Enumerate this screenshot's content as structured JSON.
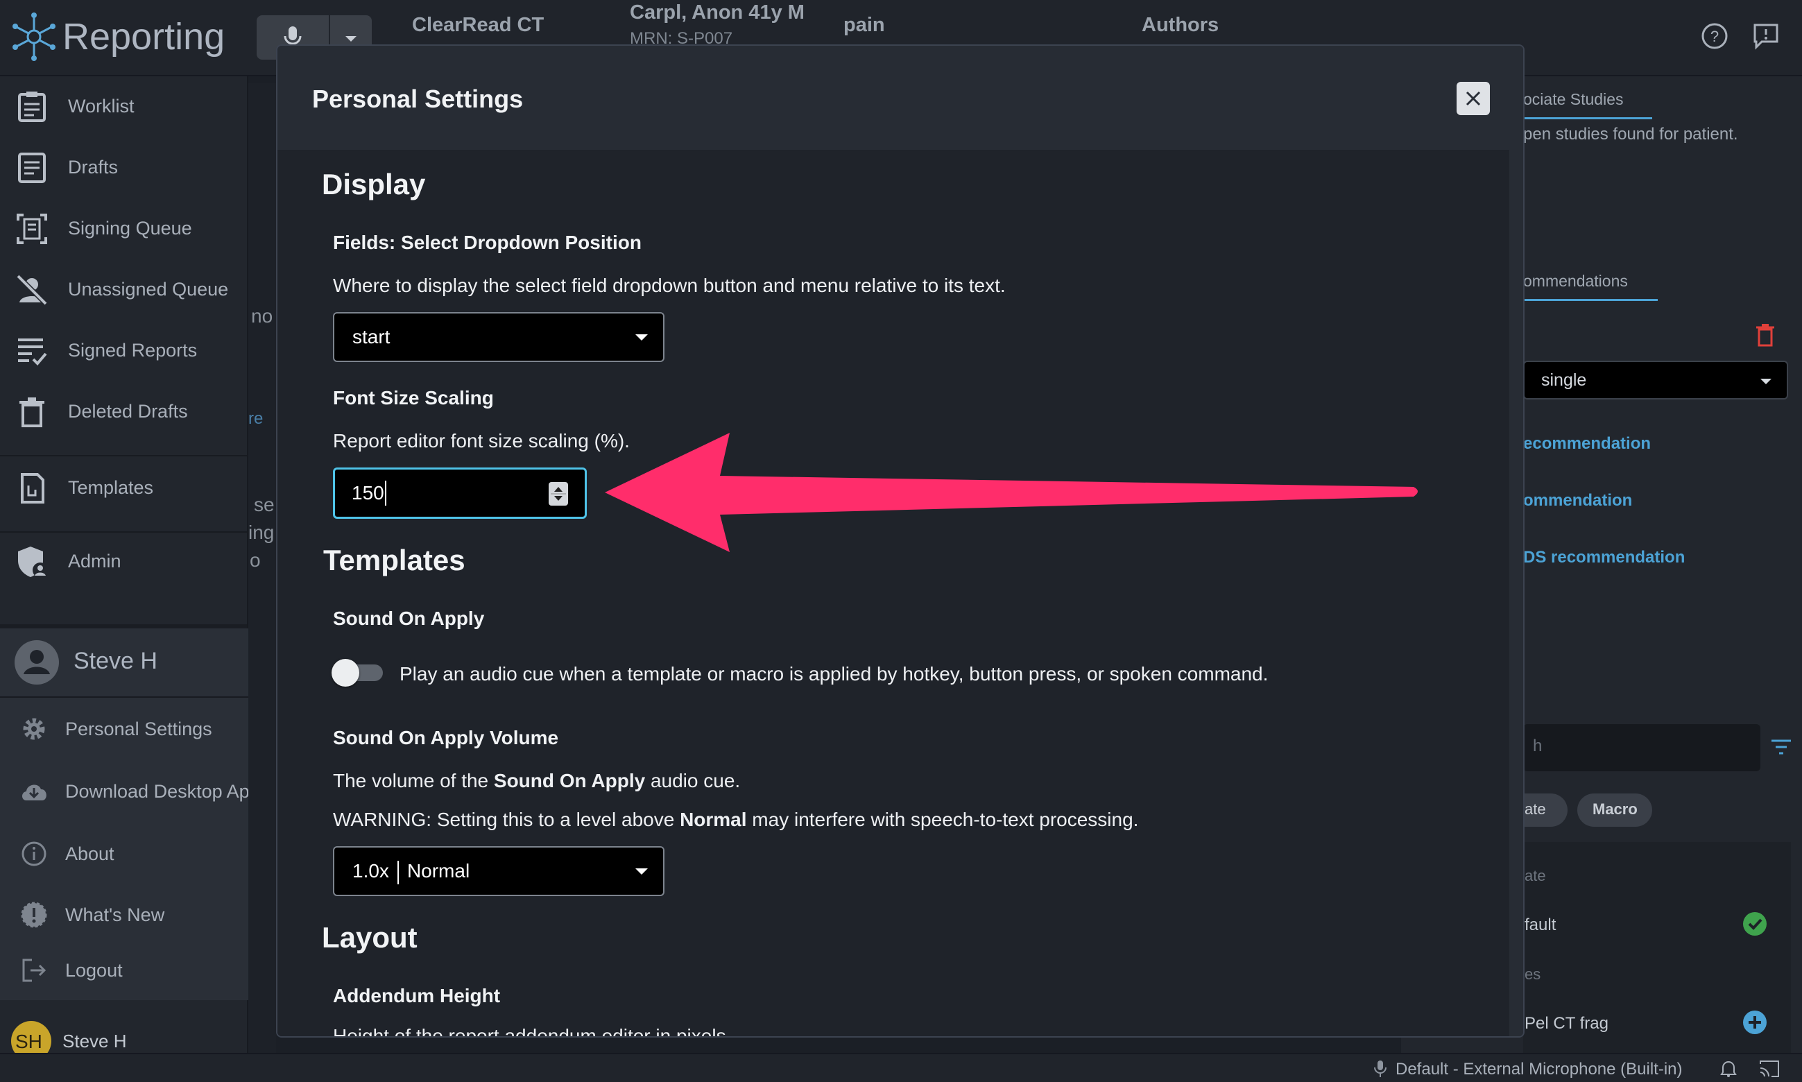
{
  "app": {
    "title": "Reporting"
  },
  "header": {
    "mode": "ClearRead CT",
    "patient_name": "Carpl, Anon 41y M",
    "mrn": "MRN: S-P007",
    "study": "pain",
    "authors_label": "Authors"
  },
  "sidebar": {
    "items": [
      {
        "label": "Worklist",
        "icon": "clipboard-list-icon"
      },
      {
        "label": "Drafts",
        "icon": "document-icon"
      },
      {
        "label": "Signing Queue",
        "icon": "signing-queue-icon"
      },
      {
        "label": "Unassigned Queue",
        "icon": "unassigned-user-icon"
      },
      {
        "label": "Signed Reports",
        "icon": "checked-list-icon"
      },
      {
        "label": "Deleted Drafts",
        "icon": "trash-icon"
      },
      {
        "label": "Templates",
        "icon": "template-icon"
      },
      {
        "label": "Admin",
        "icon": "admin-shield-icon"
      }
    ],
    "user": {
      "name": "Steve H",
      "initials": "SH"
    },
    "user_menu": [
      {
        "label": "Personal Settings",
        "icon": "gear-icon"
      },
      {
        "label": "Download Desktop App",
        "icon": "cloud-download-icon"
      },
      {
        "label": "About",
        "icon": "info-icon"
      },
      {
        "label": "What's New",
        "icon": "alert-badge-icon"
      },
      {
        "label": "Logout",
        "icon": "logout-icon"
      }
    ]
  },
  "background": {
    "fragments": [
      "no",
      "re",
      "se",
      "ing",
      "o"
    ]
  },
  "right_panel": {
    "tab_associate": "ociate Studies",
    "no_studies": "pen studies found for patient.",
    "tab_recommendations": "ommendations",
    "select_value": "single",
    "rec_items": [
      "ecommendation",
      "ommendation",
      "DS recommendation"
    ],
    "chips": [
      "ate",
      "Macro"
    ],
    "list": [
      "ate",
      "fault",
      "es",
      "Pel CT frag"
    ],
    "search_placeholder": "h"
  },
  "status_bar": {
    "microphone": "Default - External Microphone (Built-in)"
  },
  "modal": {
    "title": "Personal Settings",
    "display_heading": "Display",
    "dropdown_position": {
      "label": "Fields: Select Dropdown Position",
      "description": "Where to display the select field dropdown button and menu relative to its text.",
      "value": "start"
    },
    "font_scaling": {
      "label": "Font Size Scaling",
      "description": "Report editor font size scaling (%).",
      "value": "150"
    },
    "templates_heading": "Templates",
    "sound_on_apply": {
      "label": "Sound On Apply",
      "description": "Play an audio cue when a template or macro is applied by hotkey, button press, or spoken command.",
      "enabled": false
    },
    "sound_volume": {
      "label": "Sound On Apply Volume",
      "desc_prefix": "The volume of the ",
      "desc_bold": "Sound On Apply",
      "desc_suffix": " audio cue.",
      "warn_prefix": "WARNING: Setting this to a level above ",
      "warn_bold": "Normal",
      "warn_suffix": " may interfere with speech-to-text processing.",
      "value_multiplier": "1.0x",
      "value_name": "Normal"
    },
    "layout_heading": "Layout",
    "addendum_height": {
      "label": "Addendum Height",
      "description": "Height of the report addendum editor in pixels"
    }
  },
  "colors": {
    "accent_pink": "#ff2d6b",
    "focus_blue": "#4fc3e8",
    "link_blue": "#4ca3d6",
    "danger_red": "#e0403a",
    "success_green": "#3fa34d"
  }
}
